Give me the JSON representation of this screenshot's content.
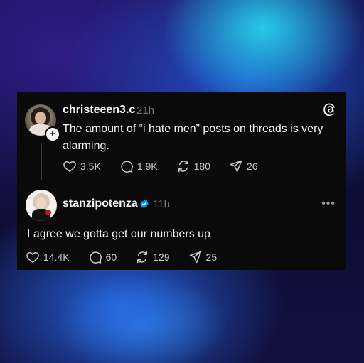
{
  "posts": [
    {
      "username": "christeeen3.c",
      "time": "21h",
      "text": "The amount of “i hate men” posts on threads is very alarming.",
      "likes": "3.5K",
      "replies": "1.9K",
      "reposts": "180",
      "shares": "26"
    },
    {
      "username": "stanzipotenza",
      "time": "11h",
      "text": "I agree we gotta get our numbers up",
      "likes": "14.4K",
      "replies": "60",
      "reposts": "129",
      "shares": "25"
    }
  ],
  "icons": {
    "brand": "threads-logo-icon",
    "follow": "plus-icon",
    "verified": "verified-badge-icon",
    "more": "more-icon",
    "like": "heart-icon",
    "reply": "comment-icon",
    "repost": "repost-icon",
    "share": "share-icon"
  },
  "colors": {
    "card_bg": "#0a0a0a",
    "text": "#f3f5f7",
    "muted": "#77777c",
    "verified": "#0095f6"
  }
}
